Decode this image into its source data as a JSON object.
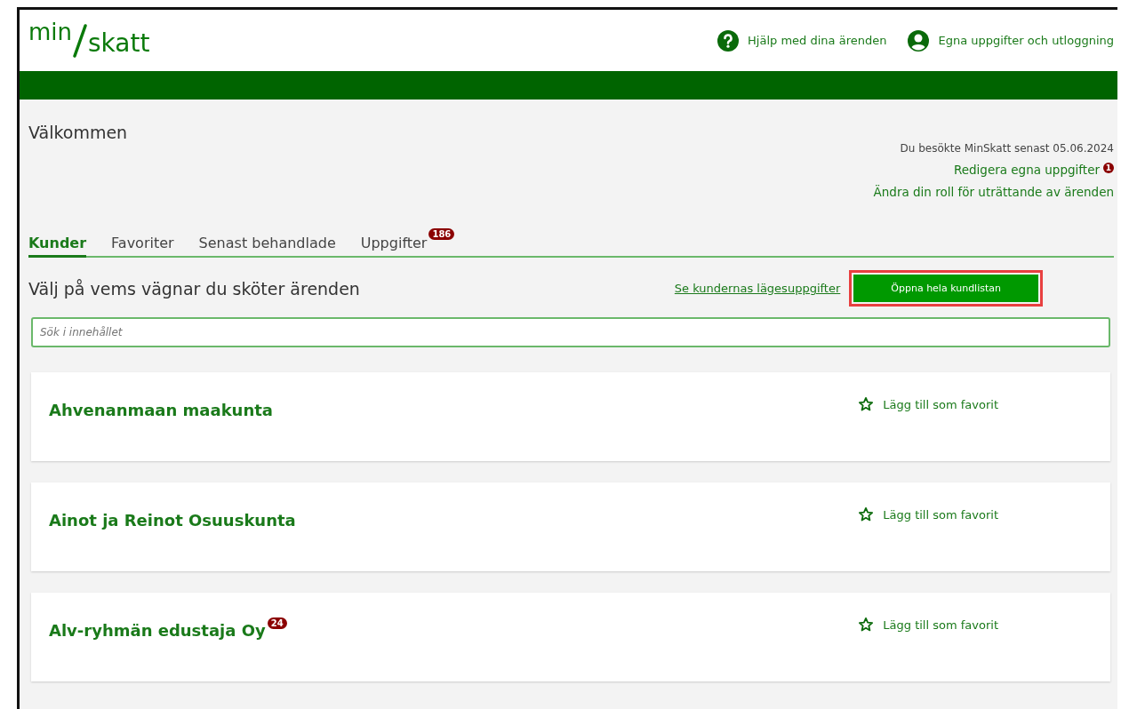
{
  "logo": {
    "top": "min",
    "bottom": "skatt"
  },
  "header_links": [
    {
      "kind": "help",
      "label": "Hjälp med dina ärenden"
    },
    {
      "kind": "user",
      "label": "Egna uppgifter och utloggning"
    }
  ],
  "welcome": {
    "title": "Välkommen",
    "last_visit": "Du besökte MinSkatt senast 05.06.2024",
    "links": [
      {
        "label": "Redigera egna uppgifter",
        "badge": "1"
      },
      {
        "label": "Ändra din roll för uträttande av ärenden"
      }
    ]
  },
  "tabs": [
    {
      "label": "Kunder",
      "selected": true
    },
    {
      "label": "Favoriter",
      "selected": false
    },
    {
      "label": "Senast behandlade",
      "selected": false
    },
    {
      "label": "Uppgifter",
      "selected": false,
      "badge": "186"
    }
  ],
  "section": {
    "title": "Välj på vems vägnar du sköter ärenden",
    "link": "Se kundernas lägesuppgifter",
    "button": {
      "label": "Öppna hela kundlistan",
      "highlighted": true
    }
  },
  "search": {
    "placeholder": "Sök i innehållet"
  },
  "customers": [
    {
      "name": "Ahvenanmaan maakunta",
      "favorite_label": "Lägg till som favorit"
    },
    {
      "name": "Ainot ja Reinot Osuuskunta",
      "favorite_label": "Lägg till som favorit"
    },
    {
      "name": "Alv-ryhmän edustaja Oy",
      "badge": "24",
      "favorite_label": "Lägg till som favorit"
    }
  ]
}
